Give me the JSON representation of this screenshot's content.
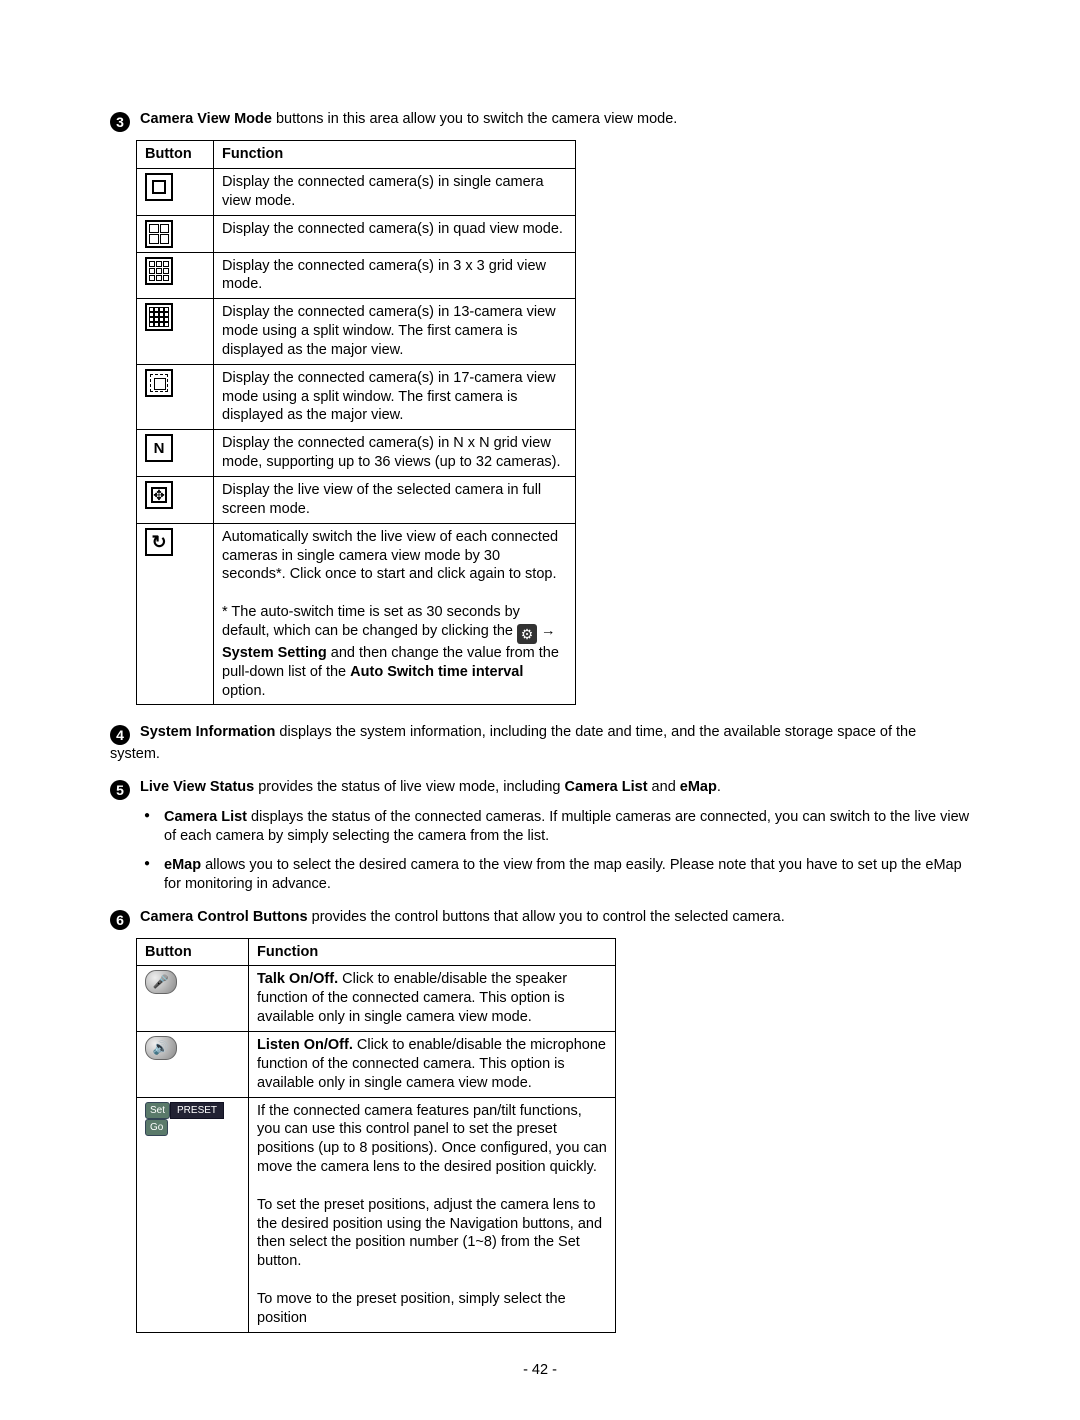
{
  "sec3": {
    "num": "3",
    "title": "Camera View Mode",
    "lead": " buttons in this area allow you to switch the camera view mode.",
    "headers": {
      "btn": "Button",
      "func": "Function"
    },
    "rows": {
      "single": "Display the connected camera(s) in single camera view mode.",
      "quad": "Display the connected camera(s) in quad view mode.",
      "grid3": "Display the connected camera(s) in 3 x 3 grid view mode.",
      "cam13": "Display the connected camera(s) in 13-camera view mode using a split window. The first camera is displayed as the major view.",
      "cam17": "Display the connected camera(s) in 17-camera view mode using a split window. The first camera is displayed as the major view.",
      "nxn": "Display the connected camera(s) in N x N grid view mode, supporting up to 36 views (up to 32 cameras).",
      "full": "Display the live view of the selected camera in full screen mode.",
      "auto_p1": "Automatically switch the live view of each connected cameras in single camera view mode by 30 seconds*. Click once to start and click again to stop.",
      "auto_p2a": "* The auto-switch time is set as 30 seconds by default, which can be changed by clicking the ",
      "auto_p2b": " → ",
      "auto_p2c": "System Setting",
      "auto_p2d": " and then change the value from the pull-down list of the ",
      "auto_p2e": "Auto Switch time interval",
      "auto_p2f": " option."
    }
  },
  "sec4": {
    "num": "4",
    "title": "System Information",
    "text": " displays the system information, including the date and time, and the available storage space of the system."
  },
  "sec5": {
    "num": "5",
    "title": "Live View Status",
    "lead_a": " provides the status of live view mode, including ",
    "lead_b": "Camera List",
    "lead_c": " and ",
    "lead_d": "eMap",
    "lead_e": ".",
    "camlist_title": "Camera List",
    "camlist_text": " displays the status of the connected cameras. If multiple cameras are connected, you can switch to the live view of each camera by simply selecting the camera from the list.",
    "emap_title": "eMap",
    "emap_text": " allows you to select the desired camera to the view from the map easily. Please note that you have to set up the eMap for monitoring in advance."
  },
  "sec6": {
    "num": "6",
    "title": "Camera Control Buttons",
    "lead": " provides the control buttons that allow you to control the selected camera.",
    "headers": {
      "btn": "Button",
      "func": "Function"
    },
    "talk_title": "Talk On/Off.",
    "talk_text": " Click to enable/disable the speaker function of the connected camera. This option is available only in single camera view mode.",
    "listen_title": "Listen On/Off.",
    "listen_text": " Click to enable/disable the microphone function of the connected camera. This option is available only in single camera view mode.",
    "preset_p1": "If the connected camera features pan/tilt functions, you can use this control panel to set the preset positions (up to 8 positions). Once configured, you can move the camera lens to the desired position quickly.",
    "preset_p2": "To set the preset positions, adjust the camera lens to the desired position using the Navigation buttons, and then select the position number (1~8) from the Set button.",
    "preset_p3": "To move to the preset position, simply select the position",
    "preset_labels": {
      "set": "Set",
      "mid": "PRESET",
      "go": "Go"
    }
  },
  "page_number": "- 42 -"
}
